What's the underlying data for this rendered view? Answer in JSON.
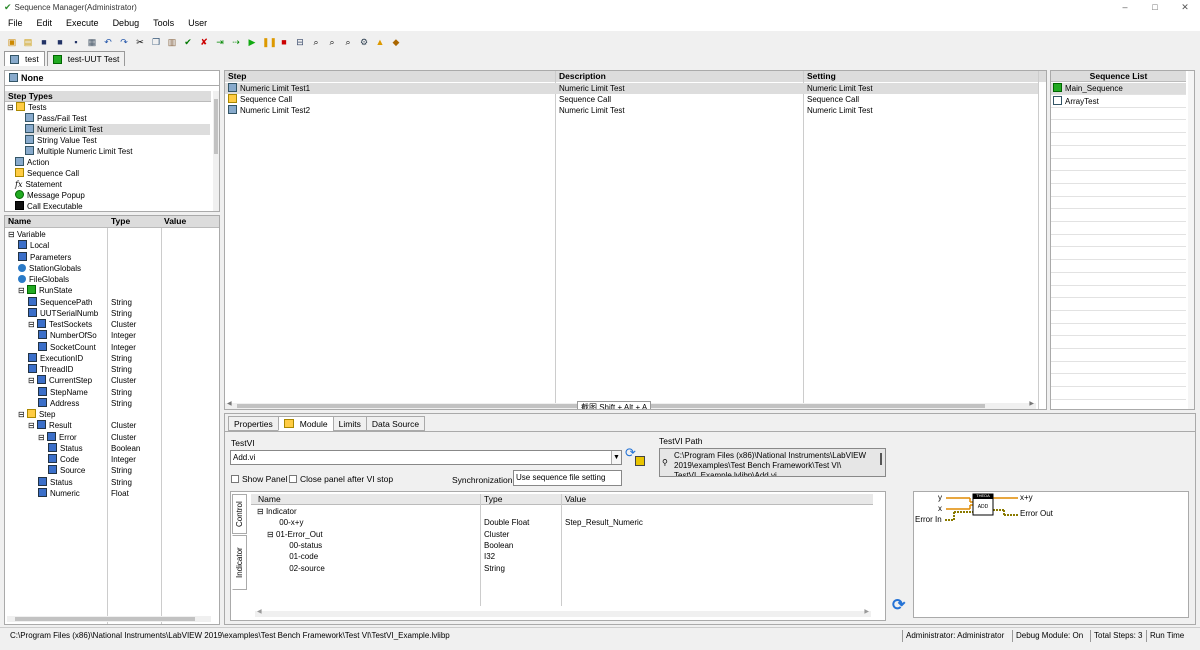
{
  "window": {
    "title": "Sequence Manager(Administrator)",
    "minimize": "–",
    "maximize": "□",
    "close": "✕"
  },
  "menu": [
    "File",
    "Edit",
    "Execute",
    "Debug",
    "Tools",
    "User"
  ],
  "doc_tabs": [
    {
      "label": "test"
    },
    {
      "label": "test-UUT Test"
    }
  ],
  "step_types_panel": {
    "none_label": "None",
    "header": "Step Types",
    "items": [
      {
        "label": "Tests",
        "prefix": "⊟"
      },
      {
        "label": "Pass/Fail Test"
      },
      {
        "label": "Numeric Limit Test"
      },
      {
        "label": "String Value Test"
      },
      {
        "label": "Multiple Numeric Limit Test"
      },
      {
        "label": "Action"
      },
      {
        "label": "Sequence Call"
      },
      {
        "label": "Statement"
      },
      {
        "label": "Message Popup"
      },
      {
        "label": "Call Executable"
      }
    ]
  },
  "variables_panel": {
    "headers": {
      "name": "Name",
      "type": "Type",
      "value": "Value"
    },
    "rows": [
      {
        "name": "Variable",
        "type": "",
        "prefix": "⊟"
      },
      {
        "name": "Local",
        "type": ""
      },
      {
        "name": "Parameters",
        "type": ""
      },
      {
        "name": "StationGlobals",
        "type": ""
      },
      {
        "name": "FileGlobals",
        "type": ""
      },
      {
        "name": "RunState",
        "type": "",
        "prefix": "⊟"
      },
      {
        "name": "SequencePath",
        "type": "String"
      },
      {
        "name": "UUTSerialNumb",
        "type": "String"
      },
      {
        "name": "TestSockets",
        "type": "Cluster",
        "prefix": "⊟"
      },
      {
        "name": "NumberOfSo",
        "type": "Integer"
      },
      {
        "name": "SocketCount",
        "type": "Integer"
      },
      {
        "name": "ExecutionID",
        "type": "String"
      },
      {
        "name": "ThreadID",
        "type": "String"
      },
      {
        "name": "CurrentStep",
        "type": "Cluster",
        "prefix": "⊟"
      },
      {
        "name": "StepName",
        "type": "String"
      },
      {
        "name": "Address",
        "type": "String"
      },
      {
        "name": "Step",
        "type": "",
        "prefix": "⊟"
      },
      {
        "name": "Result",
        "type": "Cluster",
        "prefix": "⊟"
      },
      {
        "name": "Error",
        "type": "Cluster",
        "prefix": "⊟"
      },
      {
        "name": "Status",
        "type": "Boolean"
      },
      {
        "name": "Code",
        "type": "Integer"
      },
      {
        "name": "Source",
        "type": "String"
      },
      {
        "name": "Status",
        "type": "String"
      },
      {
        "name": "Numeric",
        "type": "Float"
      }
    ]
  },
  "steps_table": {
    "headers": {
      "step": "Step",
      "description": "Description",
      "setting": "Setting"
    },
    "rows": [
      {
        "step": "Numeric Limit Test1",
        "description": "Numeric Limit Test",
        "setting": "Numeric Limit Test"
      },
      {
        "step": "Sequence Call",
        "description": "Sequence Call",
        "setting": "Sequence Call"
      },
      {
        "step": "Numeric Limit Test2",
        "description": "Numeric Limit Test",
        "setting": "Numeric Limit Test"
      }
    ],
    "tooltip": "截图 Shift + Alt + A"
  },
  "sequence_list": {
    "header": "Sequence List",
    "items": [
      "Main_Sequence",
      "ArrayTest"
    ]
  },
  "bottom_tabs": [
    "Properties",
    "Module",
    "Limits",
    "Data Source"
  ],
  "module": {
    "testvi_label": "TestVI",
    "testvi_value": "Add.vi",
    "testvi_path_label": "TestVI Path",
    "testvi_path_value": "C:\\Program Files (x86)\\National Instruments\\LabVIEW 2019\\examples\\Test Bench Framework\\Test VI\\ TestVI_Example.lvlibp\\Add.vi",
    "show_panel": "Show Panel",
    "close_panel": "Close panel after VI stop",
    "sync_label": "Synchronization:",
    "sync_value": "Use sequence file setting",
    "side_tabs": [
      "Control",
      "Indicator"
    ],
    "io_headers": {
      "name": "Name",
      "type": "Type",
      "value": "Value"
    },
    "io_rows": [
      {
        "name": "Indicator",
        "type": "",
        "value": "",
        "prefix": "⊟"
      },
      {
        "name": "00-x+y",
        "type": "Double Float",
        "value": "Step_Result_Numeric"
      },
      {
        "name": "01-Error_Out",
        "type": "Cluster",
        "value": "",
        "prefix": "⊟"
      },
      {
        "name": "00-status",
        "type": "Boolean",
        "value": ""
      },
      {
        "name": "01-code",
        "type": "I32",
        "value": ""
      },
      {
        "name": "02-source",
        "type": "String",
        "value": ""
      }
    ],
    "connector": {
      "in_y": "y",
      "in_x": "x",
      "in_err": "Error In",
      "out_sum": "x+y",
      "out_err": "Error Out",
      "vi_top": "THEDA",
      "vi_body": "ADD"
    }
  },
  "status_bar": {
    "path": "C:\\Program Files (x86)\\National Instruments\\LabVIEW 2019\\examples\\Test Bench Framework\\Test VI\\TestVI_Example.lvlibp",
    "user": "Administrator: Administrator",
    "debug": "Debug Module: On",
    "total_steps": "Total Steps: 3",
    "mode": "Run Time"
  }
}
